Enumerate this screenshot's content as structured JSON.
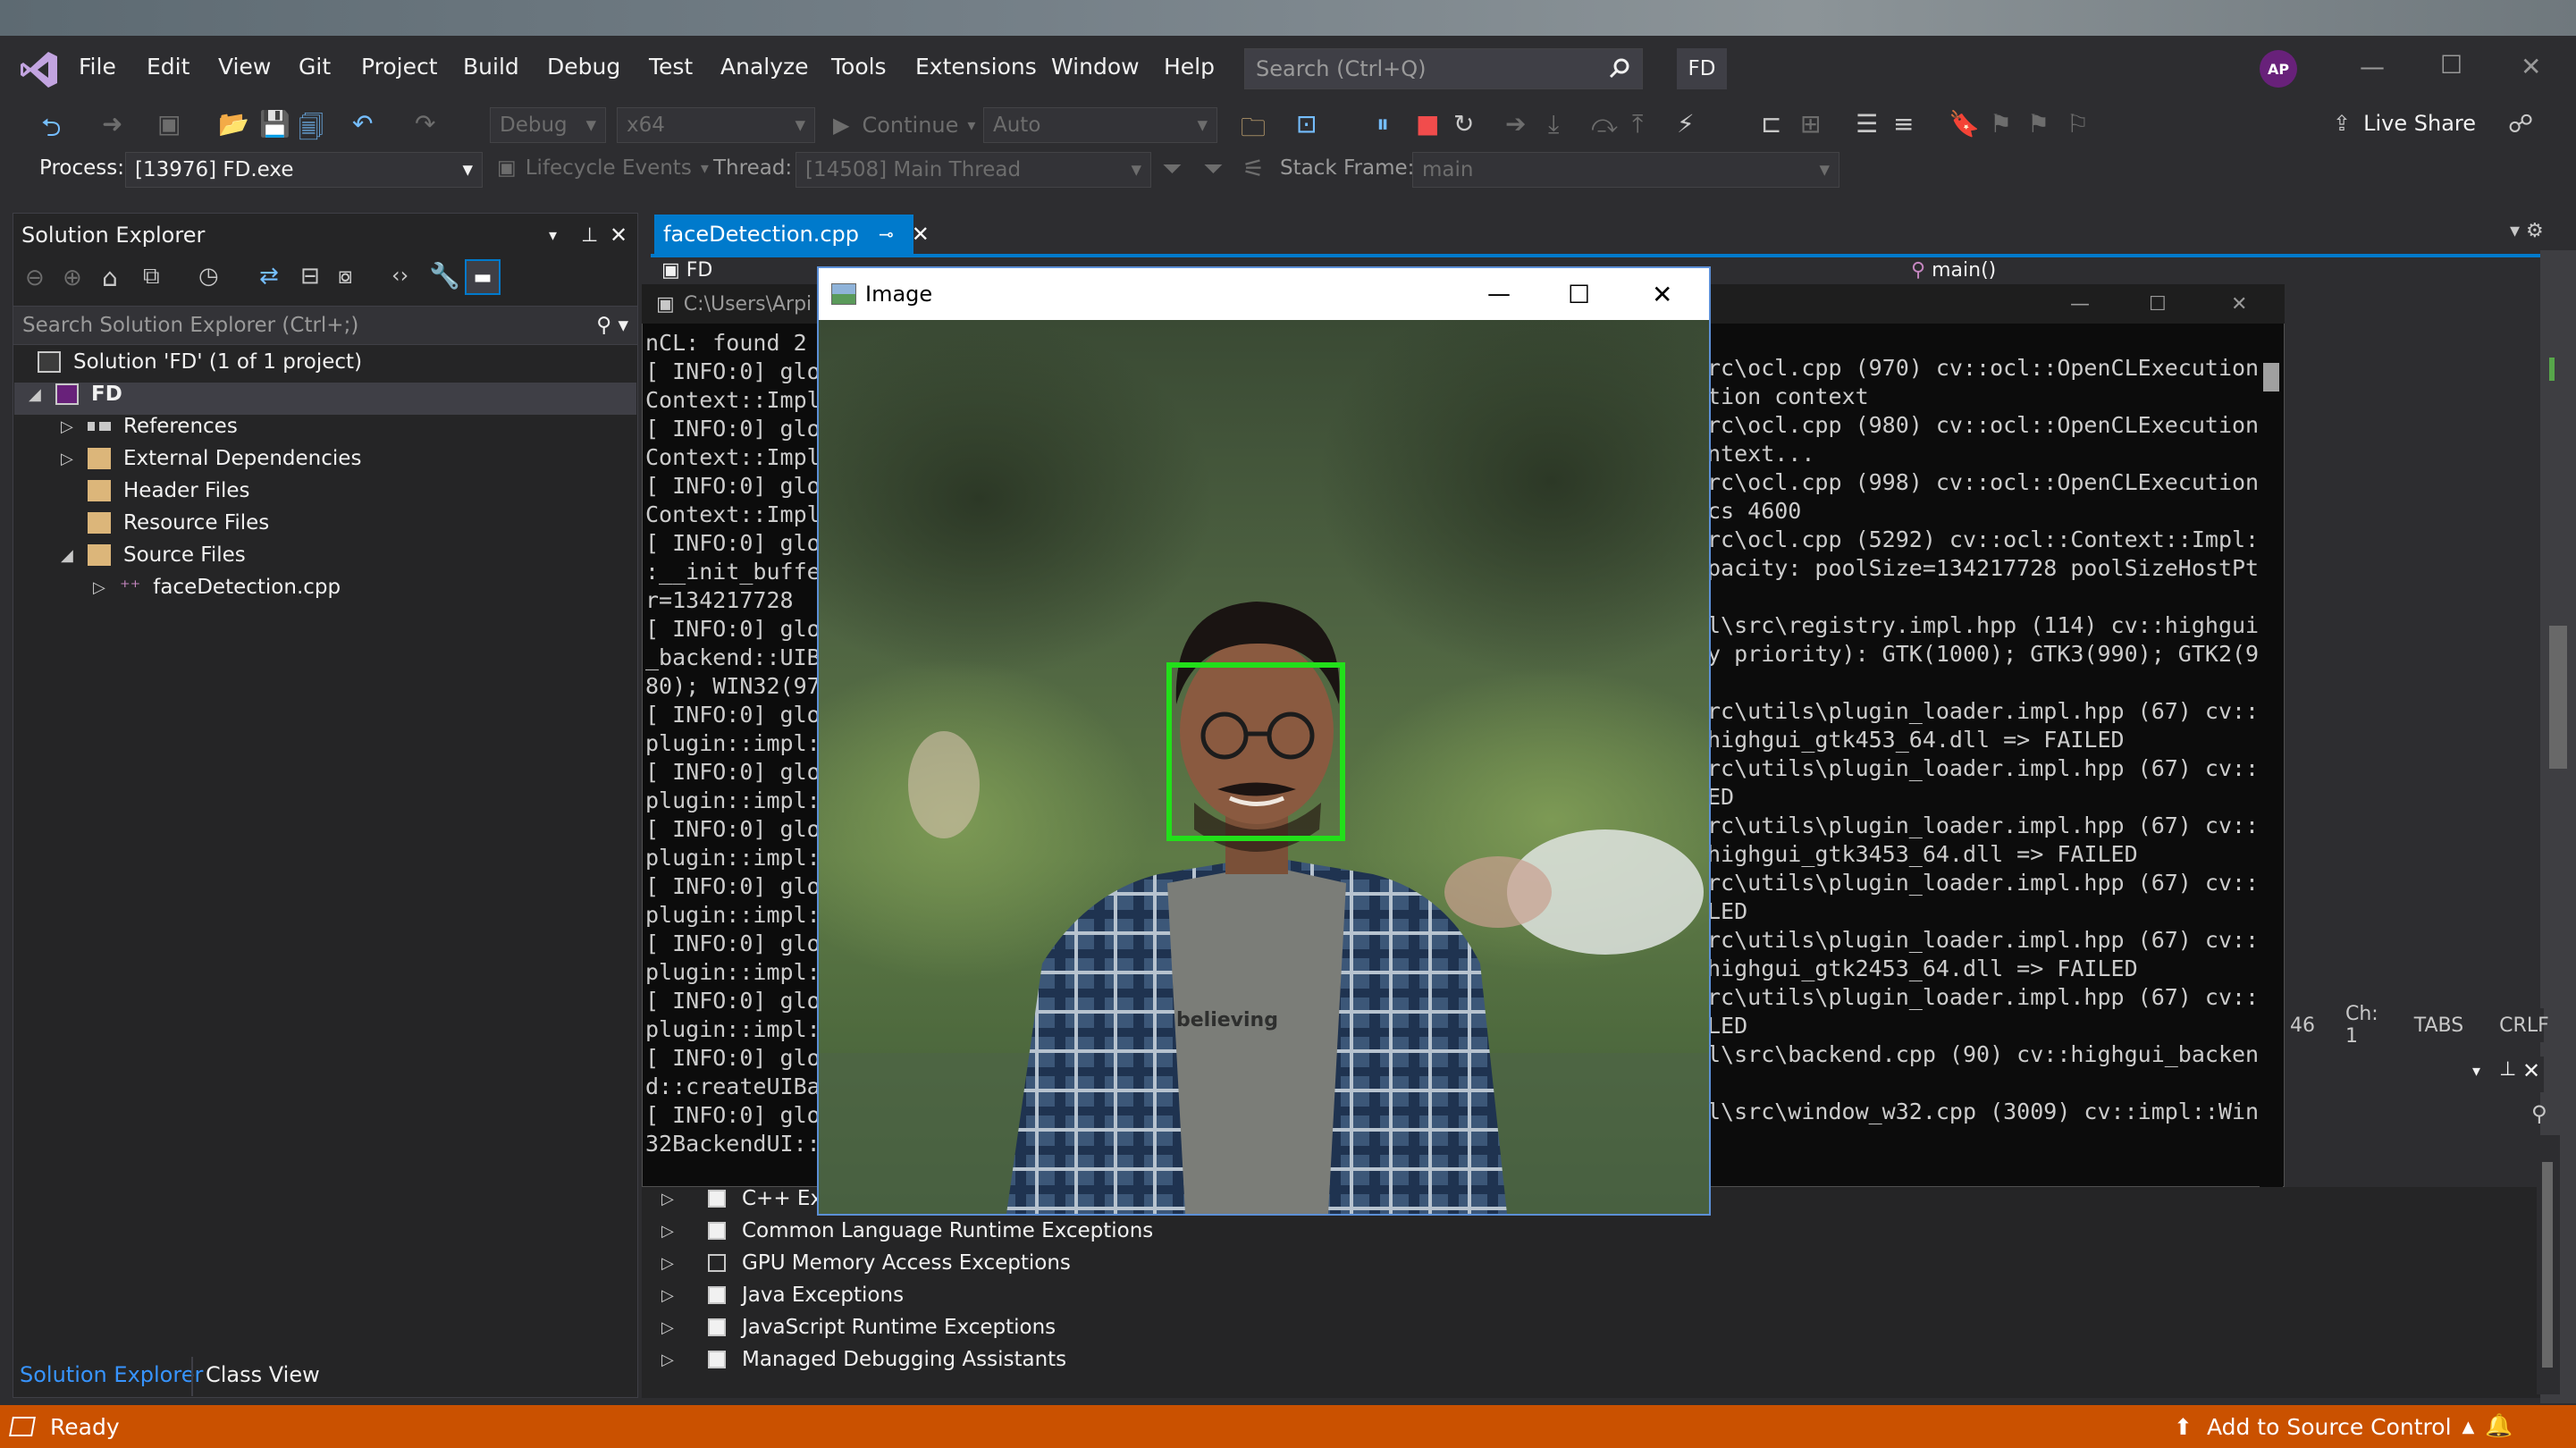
{
  "menu": {
    "items": [
      "File",
      "Edit",
      "View",
      "Git",
      "Project",
      "Build",
      "Debug",
      "Test",
      "Analyze",
      "Tools",
      "Extensions",
      "Window",
      "Help"
    ],
    "search_placeholder": "Search (Ctrl+Q)",
    "solution_name": "FD",
    "avatar_initials": "AP"
  },
  "toolbar": {
    "config": "Debug",
    "platform": "x64",
    "continue_label": "Continue",
    "auto_label": "Auto",
    "live_share": "Live Share"
  },
  "debug_location": {
    "process_label": "Process:",
    "process_value": "[13976] FD.exe",
    "lifecycle_label": "Lifecycle Events",
    "thread_label": "Thread:",
    "thread_value": "[14508] Main Thread",
    "stack_label": "Stack Frame:",
    "stack_value": "main"
  },
  "solution_explorer": {
    "title": "Solution Explorer",
    "search_placeholder": "Search Solution Explorer (Ctrl+;)",
    "solution_label": "Solution 'FD' (1 of 1 project)",
    "project": "FD",
    "nodes": [
      "References",
      "External Dependencies",
      "Header Files",
      "Resource Files",
      "Source Files"
    ],
    "file": "faceDetection.cpp",
    "bottom_tabs": [
      "Solution Explorer",
      "Class View"
    ]
  },
  "editor": {
    "tab_label": "faceDetection.cpp",
    "nav_left": "FD",
    "nav_right": "main()"
  },
  "console": {
    "title": "C:\\Users\\Arpi",
    "left_lines": [
      "nCL: found 2",
      "[ INFO:0] glo",
      "Context::Impl",
      "[ INFO:0] glo",
      "Context::Impl",
      "[ INFO:0] glo",
      "Context::Impl",
      "[ INFO:0] glo",
      ":__init_buffe",
      "r=134217728",
      "[ INFO:0] glo",
      "_backend::UIB",
      "80); WIN32(97",
      "[ INFO:0] glo",
      "plugin::impl:",
      "[ INFO:0] glo",
      "plugin::impl:",
      "[ INFO:0] glo",
      "plugin::impl:",
      "[ INFO:0] glo",
      "plugin::impl:",
      "[ INFO:0] glo",
      "plugin::impl:",
      "[ INFO:0] glo",
      "plugin::impl:",
      "[ INFO:0] glo",
      "d::createUIBa",
      "[ INFO:0] glo",
      "32BackendUI::"
    ],
    "right_lines": [
      "rc\\ocl.cpp (970) cv::ocl::OpenCLExecution",
      "tion context",
      "rc\\ocl.cpp (980) cv::ocl::OpenCLExecution",
      "ntext...",
      "rc\\ocl.cpp (998) cv::ocl::OpenCLExecution",
      "cs 4600",
      "rc\\ocl.cpp (5292) cv::ocl::Context::Impl:",
      "pacity: poolSize=134217728 poolSizeHostPt",
      "",
      "l\\src\\registry.impl.hpp (114) cv::highgui",
      "y priority): GTK(1000); GTK3(990); GTK2(9",
      "",
      "rc\\utils\\plugin_loader.impl.hpp (67) cv::",
      "highgui_gtk453_64.dll => FAILED",
      "rc\\utils\\plugin_loader.impl.hpp (67) cv::",
      "ED",
      "rc\\utils\\plugin_loader.impl.hpp (67) cv::",
      "highgui_gtk3453_64.dll => FAILED",
      "rc\\utils\\plugin_loader.impl.hpp (67) cv::",
      "LED",
      "rc\\utils\\plugin_loader.impl.hpp (67) cv::",
      "highgui_gtk2453_64.dll => FAILED",
      "rc\\utils\\plugin_loader.impl.hpp (67) cv::",
      "LED",
      "l\\src\\backend.cpp (90) cv::highgui_backen",
      "",
      "l\\src\\window_w32.cpp (3009) cv::impl::Win"
    ]
  },
  "image_window": {
    "title": "Image",
    "shirt_text": "believing"
  },
  "editor_status": {
    "line": "46",
    "col": "Ch: 1",
    "tabs": "TABS",
    "eol": "CRLF"
  },
  "exceptions": {
    "items": [
      "C++ Exce",
      "Common Language Runtime Exceptions",
      "GPU Memory Access Exceptions",
      "Java Exceptions",
      "JavaScript Runtime Exceptions",
      "Managed Debugging Assistants"
    ],
    "checked": [
      true,
      true,
      false,
      true,
      true,
      true
    ]
  },
  "statusbar": {
    "ready": "Ready",
    "source_control": "Add to Source Control"
  },
  "colors": {
    "accent": "#007acc",
    "statusbar": "#ca5100",
    "face_box": "#22e01a"
  }
}
